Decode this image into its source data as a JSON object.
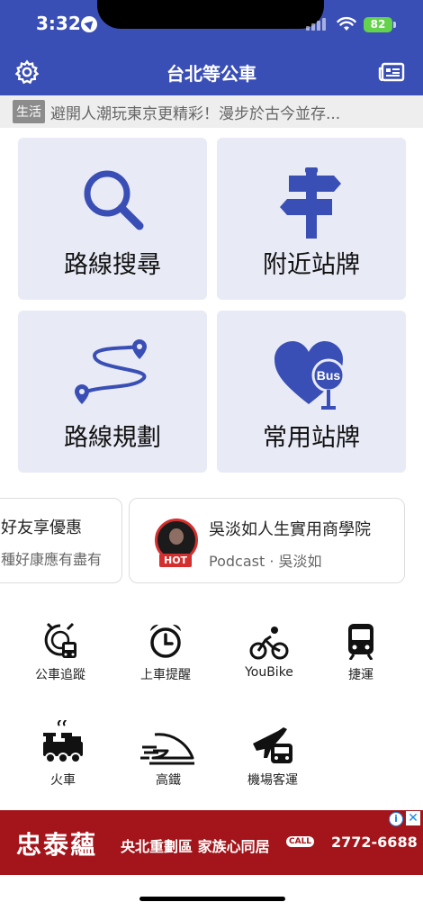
{
  "status_bar": {
    "time": "3:32",
    "battery": "82"
  },
  "header": {
    "title": "台北等公車"
  },
  "ticker": {
    "tag": "生活",
    "text": "避開人潮玩東京更精彩！漫步於古今並存..."
  },
  "tiles": [
    {
      "label": "路線搜尋",
      "icon": "search-icon"
    },
    {
      "label": "附近站牌",
      "icon": "signpost-icon"
    },
    {
      "label": "路線規劃",
      "icon": "route-icon"
    },
    {
      "label": "常用站牌",
      "icon": "heart-bus-stop-icon",
      "icon_text": "Bus"
    }
  ],
  "promos": {
    "left": {
      "line1": "好友享優惠",
      "line2": "種好康應有盡有"
    },
    "right": {
      "line1": "吳淡如人生實用商學院",
      "line2": "Podcast · 吳淡如",
      "badge": "HOT"
    }
  },
  "shortcuts": [
    {
      "label": "公車追蹤",
      "icon": "bus-tracking-icon"
    },
    {
      "label": "上車提醒",
      "icon": "alarm-clock-icon"
    },
    {
      "label": "YouBike",
      "icon": "bicycle-icon"
    },
    {
      "label": "捷運",
      "icon": "metro-train-icon"
    },
    {
      "label": "火車",
      "icon": "steam-train-icon"
    },
    {
      "label": "高鐵",
      "icon": "high-speed-rail-icon"
    },
    {
      "label": "機場客運",
      "icon": "airport-bus-icon"
    }
  ],
  "ad": {
    "brand": "忠泰蘊",
    "copy": "央北重劃區 家族心同居",
    "phone_tag": "CALL",
    "phone": "2772-6688"
  },
  "colors": {
    "primary": "#3a4fb5",
    "tile_bg": "#e8eaf6",
    "ad_bg": "#a3151a"
  }
}
